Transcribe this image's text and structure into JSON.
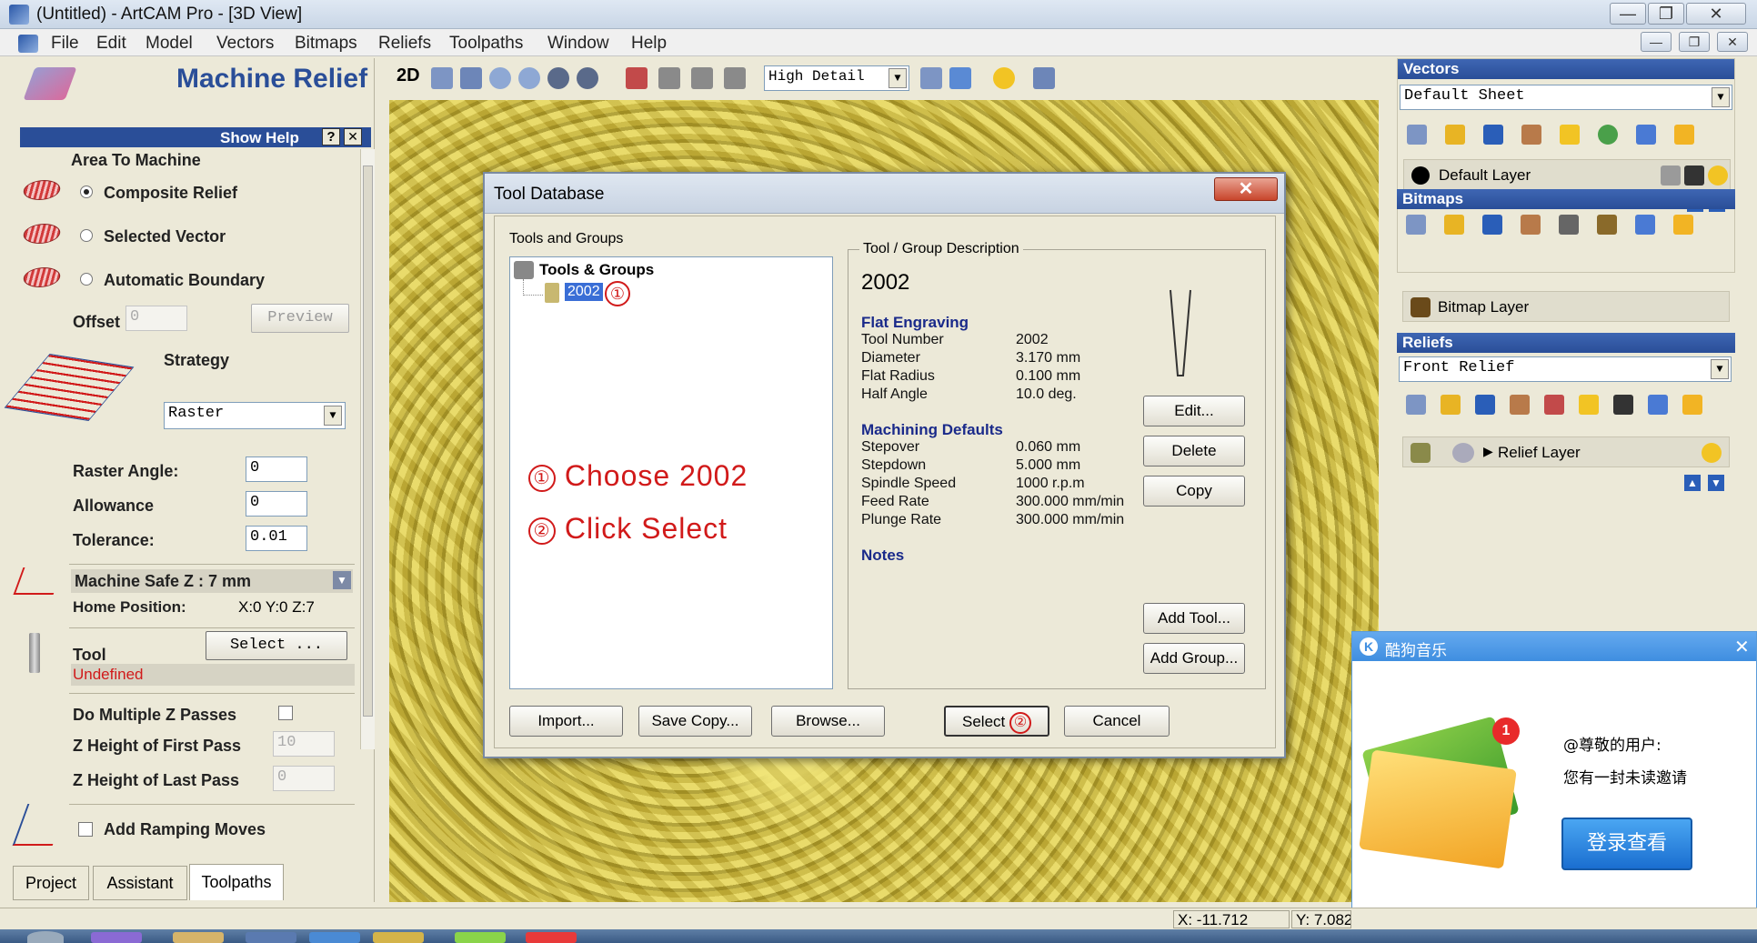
{
  "window": {
    "title": "(Untitled) - ArtCAM Pro - [3D View]"
  },
  "menu": [
    "File",
    "Edit",
    "Model",
    "Vectors",
    "Bitmaps",
    "Reliefs",
    "Toolpaths",
    "Window",
    "Help"
  ],
  "left_panel": {
    "title": "Machine Relief",
    "show_help": "Show Help",
    "help_btn": "?",
    "close_btn": "✕",
    "area_to_machine": "Area To Machine",
    "options": [
      "Composite Relief",
      "Selected Vector",
      "Automatic Boundary"
    ],
    "selected_option": "Composite Relief",
    "offset_label": "Offset",
    "offset_value": "0",
    "preview_btn": "Preview",
    "strategy_label": "Strategy",
    "strategy_value": "Raster",
    "raster_angle_label": "Raster Angle:",
    "raster_angle_value": "0",
    "allowance_label": "Allowance",
    "allowance_value": "0",
    "tolerance_label": "Tolerance:",
    "tolerance_value": "0.01",
    "safe_z_label": "Machine Safe Z : 7 mm",
    "home_label": "Home Position:",
    "home_value": "X:0 Y:0 Z:7",
    "tool_label": "Tool",
    "tool_select_btn": "Select ...",
    "tool_status": "Undefined",
    "multi_z_label": "Do Multiple Z Passes",
    "z_first_label": "Z Height of First Pass",
    "z_first_value": "10",
    "z_last_label": "Z Height of Last Pass",
    "z_last_value": "0",
    "ramping_label": "Add Ramping Moves",
    "tabs": [
      "Project",
      "Assistant",
      "Toolpaths"
    ],
    "active_tab": "Toolpaths"
  },
  "view_toolbar": {
    "mode_label": "2D",
    "detail_value": "High Detail"
  },
  "right_panel": {
    "vectors": {
      "title": "Vectors",
      "sheet": "Default Sheet",
      "layer": "Default Layer"
    },
    "bitmaps": {
      "title": "Bitmaps",
      "layer": "Bitmap Layer"
    },
    "reliefs": {
      "title": "Reliefs",
      "relief": "Front Relief",
      "layer": "Relief Layer"
    }
  },
  "dialog": {
    "title": "Tool Database",
    "close": "✕",
    "tree_group_label": "Tools and Groups",
    "tree_root": "Tools & Groups",
    "tree_item": "2002",
    "desc_group_label": "Tool / Group Description",
    "tool_name": "2002",
    "section1": "Flat Engraving",
    "params1": [
      {
        "k": "Tool Number",
        "v": "2002"
      },
      {
        "k": "Diameter",
        "v": "3.170 mm"
      },
      {
        "k": "Flat Radius",
        "v": "0.100 mm"
      },
      {
        "k": "Half Angle",
        "v": "10.0 deg."
      }
    ],
    "section2": "Machining Defaults",
    "params2": [
      {
        "k": "Stepover",
        "v": "0.060 mm"
      },
      {
        "k": "Stepdown",
        "v": "5.000 mm"
      },
      {
        "k": "Spindle Speed",
        "v": "1000 r.p.m"
      },
      {
        "k": "Feed Rate",
        "v": "300.000 mm/min"
      },
      {
        "k": "Plunge Rate",
        "v": "300.000 mm/min"
      }
    ],
    "notes_label": "Notes",
    "side_buttons": [
      "Edit...",
      "Delete",
      "Copy"
    ],
    "add_buttons": [
      "Add Tool...",
      "Add Group..."
    ],
    "bottom_buttons": [
      "Import...",
      "Save Copy...",
      "Browse..."
    ],
    "select_btn": "Select",
    "cancel_btn": "Cancel",
    "annotation_1": "Choose 2002",
    "annotation_2": "Click Select",
    "marker_1": "①",
    "marker_2": "②"
  },
  "popup": {
    "app": "酷狗音乐",
    "greeting": "@尊敬的用户:",
    "message": "您有一封未读邀请",
    "button": "登录查看",
    "badge": "1"
  },
  "status": {
    "x": "X: -11.712",
    "y": "Y: 7.082"
  },
  "colors": {
    "panel_head": "#2a4e98",
    "annotation": "#d11a1a",
    "relief_gold": "#d4c247"
  }
}
